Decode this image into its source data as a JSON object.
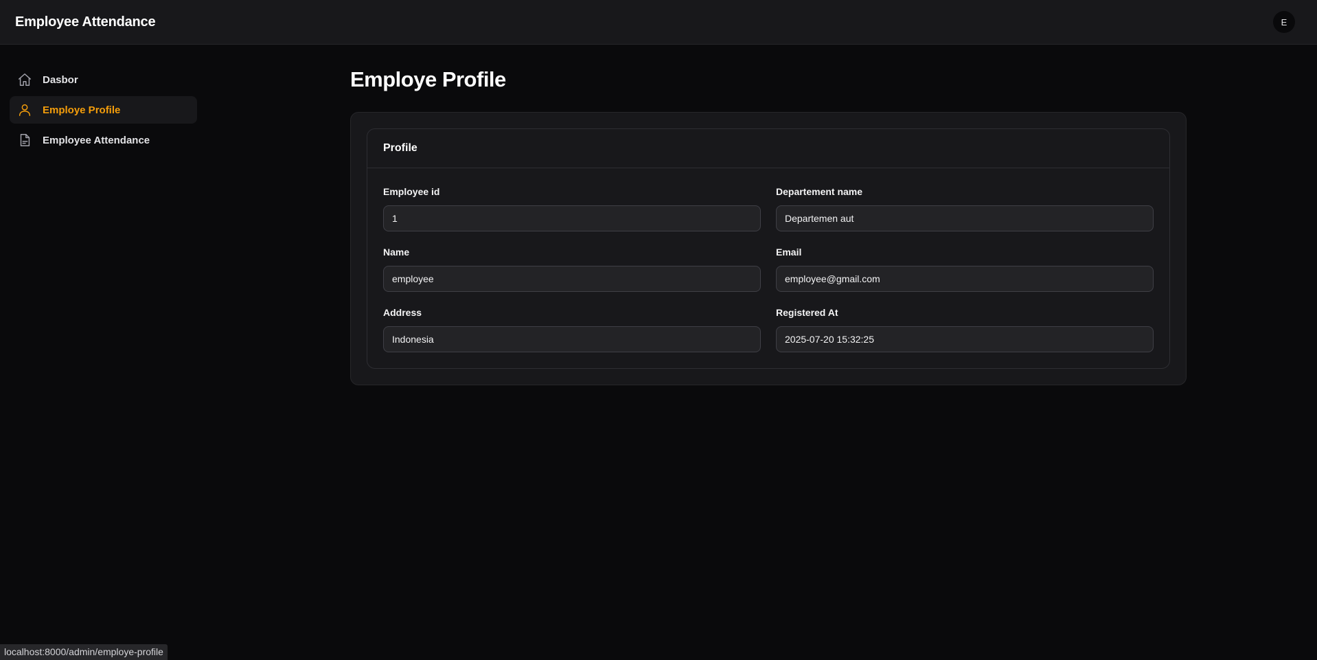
{
  "app": {
    "title": "Employee Attendance",
    "avatar_initial": "E"
  },
  "sidebar": {
    "items": [
      {
        "label": "Dasbor",
        "icon": "home-icon"
      },
      {
        "label": "Employe Profile",
        "icon": "user-icon",
        "active": true
      },
      {
        "label": "Employee Attendance",
        "icon": "document-icon"
      }
    ]
  },
  "main": {
    "title": "Employe Profile",
    "card": {
      "title": "Profile",
      "fields": {
        "employee_id": {
          "label": "Employee id",
          "value": "1"
        },
        "department": {
          "label": "Departement name",
          "value": "Departemen aut"
        },
        "name": {
          "label": "Name",
          "value": "employee"
        },
        "email": {
          "label": "Email",
          "value": "employee@gmail.com"
        },
        "address": {
          "label": "Address",
          "value": "Indonesia"
        },
        "registered_at": {
          "label": "Registered At",
          "value": "2025-07-20 15:32:25"
        }
      }
    }
  },
  "statusbar": {
    "url": "localhost:8000/admin/employe-profile"
  },
  "colors": {
    "accent": "#f59e0b",
    "background": "#0a0a0c",
    "panel": "#18181b"
  }
}
